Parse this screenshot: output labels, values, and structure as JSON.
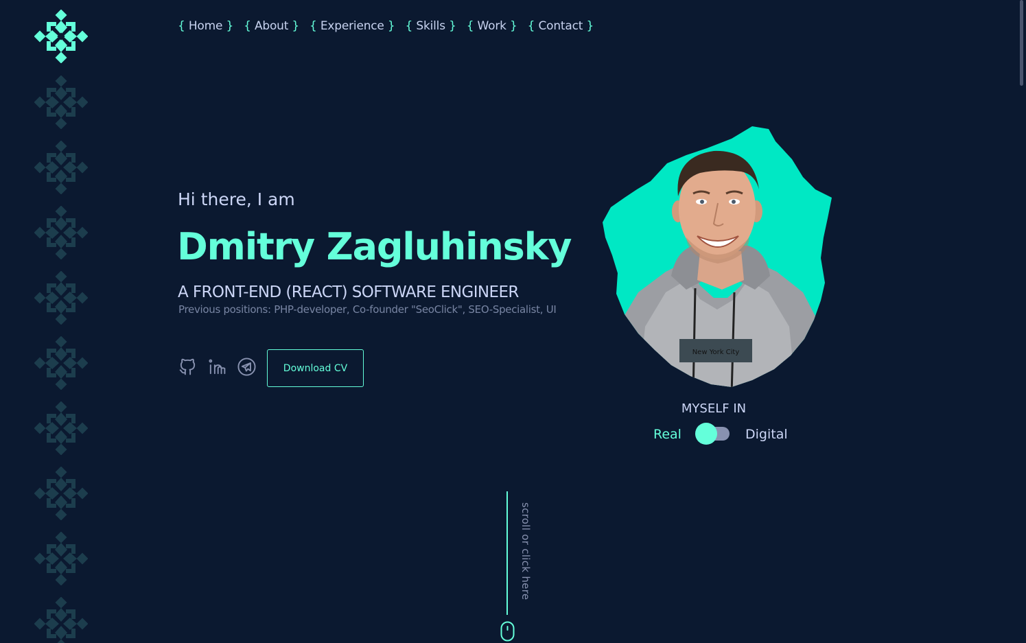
{
  "nav": {
    "items": [
      {
        "label": "Home"
      },
      {
        "label": "About"
      },
      {
        "label": "Experience"
      },
      {
        "label": "Skills"
      },
      {
        "label": "Work"
      },
      {
        "label": "Contact"
      }
    ],
    "bracket_open": "{",
    "bracket_close": "}"
  },
  "hero": {
    "greeting": "Hi there, I am",
    "name": "Dmitry Zagluhinsky",
    "role": "A FRONT-END (REACT) SOFTWARE ENGINEER",
    "previous": "Previous positions: PHP-developer, Co-founder \"SeoClick\", SEO-Specialist, UI",
    "cv_button": "Download CV"
  },
  "social": [
    {
      "icon": "github-icon"
    },
    {
      "icon": "linkedin-icon"
    },
    {
      "icon": "telegram-icon"
    }
  ],
  "photo": {
    "shirt_text": "New York City"
  },
  "toggle": {
    "label": "MYSELF IN",
    "left": "Real",
    "right": "Digital",
    "selected": "Real"
  },
  "scroll_hint": "scroll or click here",
  "colors": {
    "background": "#0b1930",
    "accent": "#64ffda",
    "text": "#ccd6f6",
    "muted": "#8892b0",
    "flake_dim": "#1c3d4d"
  },
  "icons": {
    "logo": "snowflake-icon",
    "decor": "snowflake-icon",
    "mouse": "mouse-icon"
  }
}
